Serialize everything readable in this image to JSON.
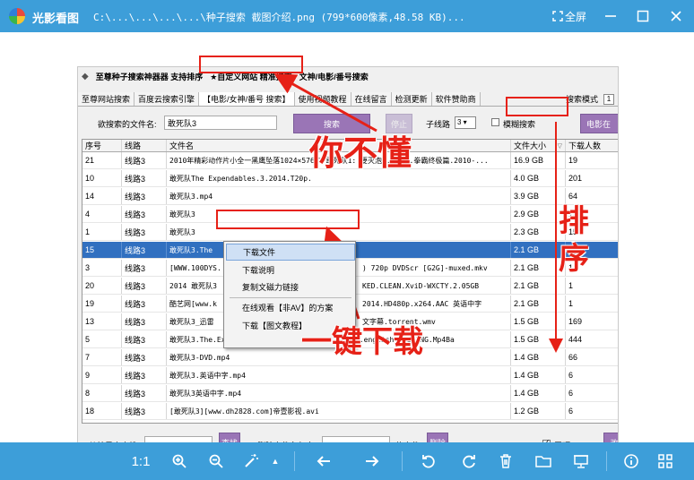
{
  "window": {
    "app_name": "光影看图",
    "file_title": "C:\\...\\...\\...\\...\\种子搜索 截图介绍.png (799*600像素,48.58 KB)...",
    "fullscreen_label": "全屏"
  },
  "toplinks": [
    "至尊种子搜索神器器 支持排序",
    "★自定义网站 精准搜索",
    "文神/电影/番号搜索"
  ],
  "tabs": [
    "至尊网站搜索",
    "百度云搜索引擎",
    "【电影/女神/番号 搜索】",
    "使用视频教程",
    "在线留言",
    "检测更新",
    "软件赞助商"
  ],
  "search_mode": {
    "label": "搜索模式",
    "value": "1"
  },
  "search": {
    "label": "欲搜索的文件名:",
    "query": "敢死队3",
    "search_button": "搜索",
    "stop_button": "停止",
    "route_label": "子线路",
    "route_value": "3",
    "fuzzy_label": "模糊搜索",
    "movie_button": "电影在"
  },
  "table": {
    "headers": [
      "序号",
      "线路",
      "文件名",
      "文件大小",
      "下载人数"
    ],
    "rows": [
      [
        "21",
        "线路3",
        "2010年精彩动作片小全一黑鹰坠落1024×576中+敢死队1: 要灭泡+.拳霸3.拳霸终极篇.2010-...",
        "16.9 GB",
        "19"
      ],
      [
        "10",
        "线路3",
        "敢死队The Expendables.3.2014.T20p.",
        "4.0 GB",
        "201"
      ],
      [
        "14",
        "线路3",
        "敢死队3.mp4",
        "3.9 GB",
        "64"
      ],
      [
        "4",
        "线路3",
        "敢死队3",
        "2.9 GB",
        "15"
      ],
      [
        "1",
        "线路3",
        "敢死队3",
        "2.3 GB",
        "15"
      ],
      [
        "15",
        "线路3",
        "敢死队3.The",
        "2.1 GB",
        "1"
      ],
      [
        "3",
        "线路3",
        "[WWW.100DYS.",
        ") 720p DVDScr [G2G]-muxed.mkv",
        "2.1 GB",
        "1"
      ],
      [
        "20",
        "线路3",
        "2014 敢死队3",
        "KED.CLEAN.XviD-WXCTY.2.05GB",
        "2.1 GB",
        "1"
      ],
      [
        "19",
        "线路3",
        "酷艺网[www.k",
        "2014.HD480p.x264.AAC 英语中字",
        "2.1 GB",
        "1"
      ],
      [
        "13",
        "线路3",
        "敢死队3_迅雷",
        "文字幕.torrent.wmv",
        "1.5 GB",
        "169"
      ],
      [
        "5",
        "线路3",
        "敢死队3.The.Expendables.3.2014.DVDScr.X264.AC.english.CHS-ENG.Mp4Ba",
        "1.5 GB",
        "444"
      ],
      [
        "7",
        "线路3",
        "敢死队3-DVD.mp4",
        "1.4 GB",
        "66"
      ],
      [
        "9",
        "线路3",
        "敢死队3.英语中字.mp4",
        "1.4 GB",
        "6"
      ],
      [
        "8",
        "线路3",
        "敢死队3英语中字.mp4",
        "1.4 GB",
        "6"
      ],
      [
        "18",
        "线路3",
        "[敢死队3][www.dh2828.com]帝壹影视.avi",
        "1.2 GB",
        "6"
      ]
    ]
  },
  "context_menu": [
    "下载文件",
    "下载说明",
    "复制文磁力链接",
    "在线观看【非AV】的方案",
    "下载【图文教程】"
  ],
  "bottom": {
    "find_label": "从结果中查找:",
    "find_button": "查找",
    "delete_label": "删除文件名包含:",
    "delete_suffix": "的文件",
    "delete_button": "删除",
    "pin_label": "置顶",
    "extra_button": "改"
  },
  "annotations": {
    "dont_understand": "你不懂",
    "sort": "排序",
    "one_click": "一键下载"
  },
  "statusbar": {
    "ratio": "1:1"
  },
  "colors": {
    "titlebar": "#3d9ed9",
    "annotation": "#e62117",
    "selection": "#3170c0",
    "button": "#9a75b6"
  }
}
